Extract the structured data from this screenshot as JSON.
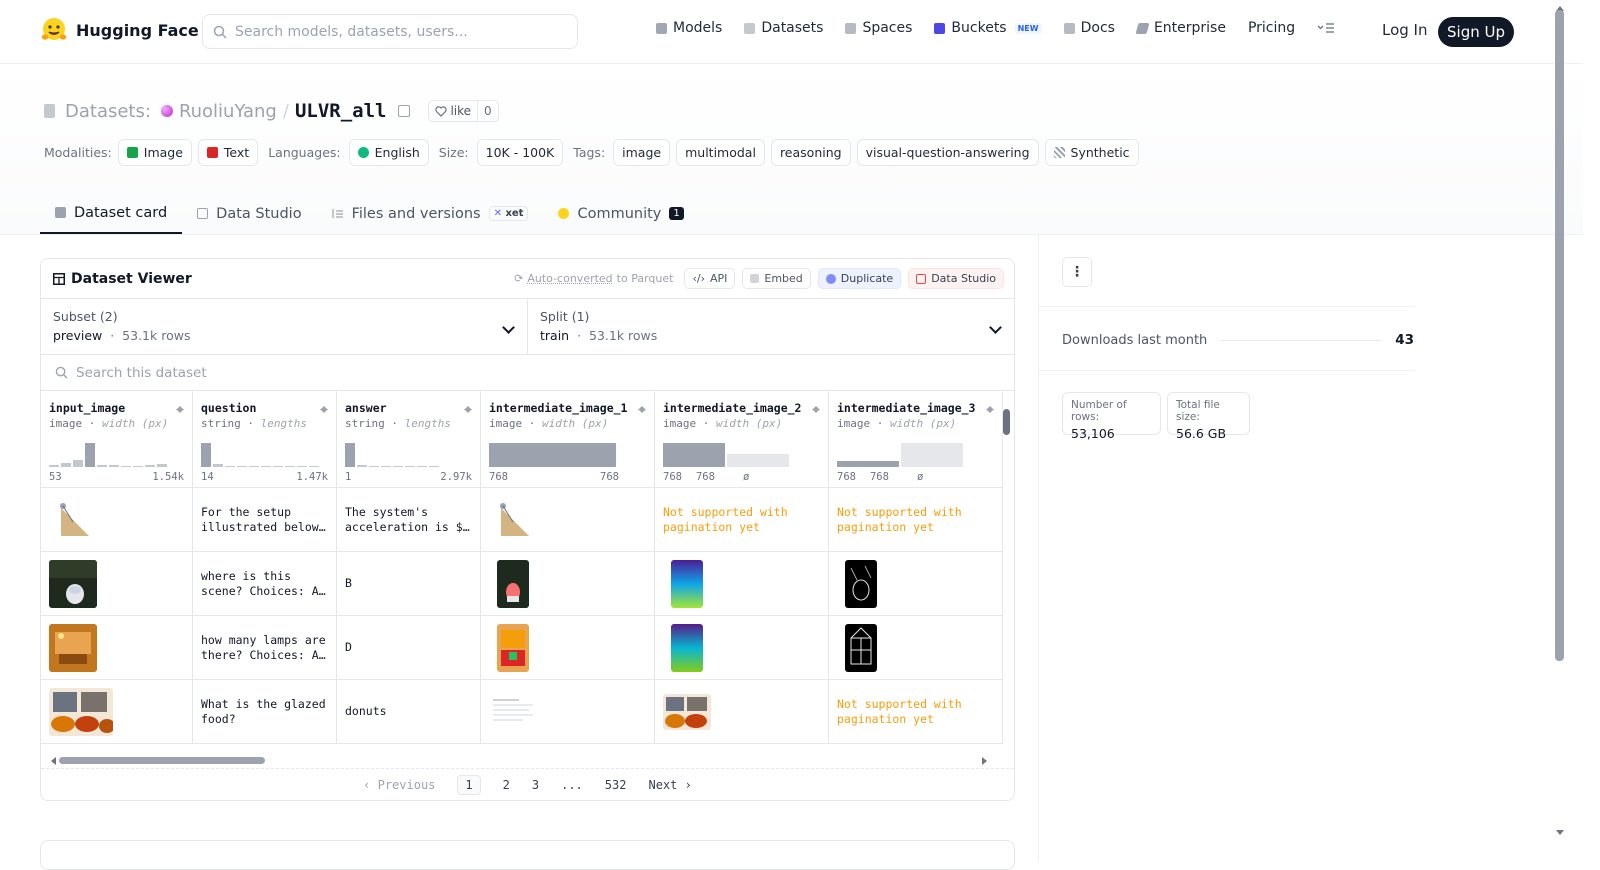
{
  "header": {
    "brand": "Hugging Face",
    "search_placeholder": "Search models, datasets, users...",
    "nav": [
      {
        "label": "Models",
        "icon": "model-cube-icon"
      },
      {
        "label": "Datasets",
        "icon": "database-icon"
      },
      {
        "label": "Spaces",
        "icon": "spaces-grid-icon"
      },
      {
        "label": "Buckets",
        "icon": "bucket-icon",
        "badge": "NEW"
      },
      {
        "label": "Docs",
        "icon": "book-icon"
      },
      {
        "label": "Enterprise",
        "icon": "enterprise-icon"
      },
      {
        "label": "Pricing"
      }
    ],
    "login": "Log In",
    "signup": "Sign Up"
  },
  "repo": {
    "type_label": "Datasets:",
    "owner": "RuoliuYang",
    "sep": "/",
    "name": "ULVR_all",
    "like_label": "like",
    "like_count": "0"
  },
  "tags": {
    "modalities_label": "Modalities:",
    "modalities": [
      "Image",
      "Text"
    ],
    "languages_label": "Languages:",
    "languages": [
      "English"
    ],
    "size_label": "Size:",
    "size": "10K - 100K",
    "tags_label": "Tags:",
    "tags": [
      "image",
      "multimodal",
      "reasoning",
      "visual-question-answering",
      "Synthetic"
    ]
  },
  "tabs": [
    {
      "label": "Dataset card",
      "active": true
    },
    {
      "label": "Data Studio"
    },
    {
      "label": "Files and versions",
      "badge": "xet"
    },
    {
      "label": "Community",
      "count": "1"
    }
  ],
  "viewer": {
    "title": "Dataset Viewer",
    "auto_converted_a": "Auto-converted",
    "auto_converted_b": "to Parquet",
    "buttons": [
      "API",
      "Embed",
      "Duplicate",
      "Data Studio"
    ],
    "subset_label": "Subset (2)",
    "subset_value": "preview",
    "subset_rows": "53.1k rows",
    "split_label": "Split (1)",
    "split_value": "train",
    "split_rows": "53.1k rows",
    "search_placeholder": "Search this dataset",
    "columns": [
      {
        "name": "input_image",
        "type": "image",
        "stat": "width (px)",
        "min": "53",
        "max": "1.54k"
      },
      {
        "name": "question",
        "type": "string",
        "stat": "lengths",
        "min": "14",
        "max": "1.47k"
      },
      {
        "name": "answer",
        "type": "string",
        "stat": "lengths",
        "min": "1",
        "max": "2.97k"
      },
      {
        "name": "intermediate_image_1",
        "type": "image",
        "stat": "width (px)",
        "min": "768",
        "max": "768"
      },
      {
        "name": "intermediate_image_2",
        "type": "image",
        "stat": "width (px)",
        "min": "768",
        "mid": "768",
        "null": "ø"
      },
      {
        "name": "intermediate_image_3",
        "type": "image",
        "stat": "width (px)",
        "min": "768",
        "mid": "768",
        "null": "ø"
      }
    ],
    "rows": [
      {
        "question": "For the setup illustrated below…",
        "answer": "The system's acceleration is $…",
        "img2": "Not supported with pagination yet",
        "img3": "Not supported with pagination yet"
      },
      {
        "question": "where is this scene? Choices: A…",
        "answer": "B"
      },
      {
        "question": "how many lamps are there? Choices: A…",
        "answer": "D"
      },
      {
        "question": "What is the glazed food?",
        "answer": "donuts",
        "img3": "Not supported with pagination yet"
      }
    ],
    "pager": {
      "prev": "Previous",
      "pages": [
        "1",
        "2",
        "3",
        "...",
        "532"
      ],
      "next": "Next"
    }
  },
  "sidebar": {
    "downloads_label": "Downloads last month",
    "downloads_value": "43",
    "rows_label": "Number of rows:",
    "rows_value": "53,106",
    "size_label": "Total file size:",
    "size_value": "56.6 GB"
  },
  "colors": {
    "accent": "#111827",
    "warning_text": "#f59e0b",
    "brand_yellow": "#FFD21E"
  }
}
